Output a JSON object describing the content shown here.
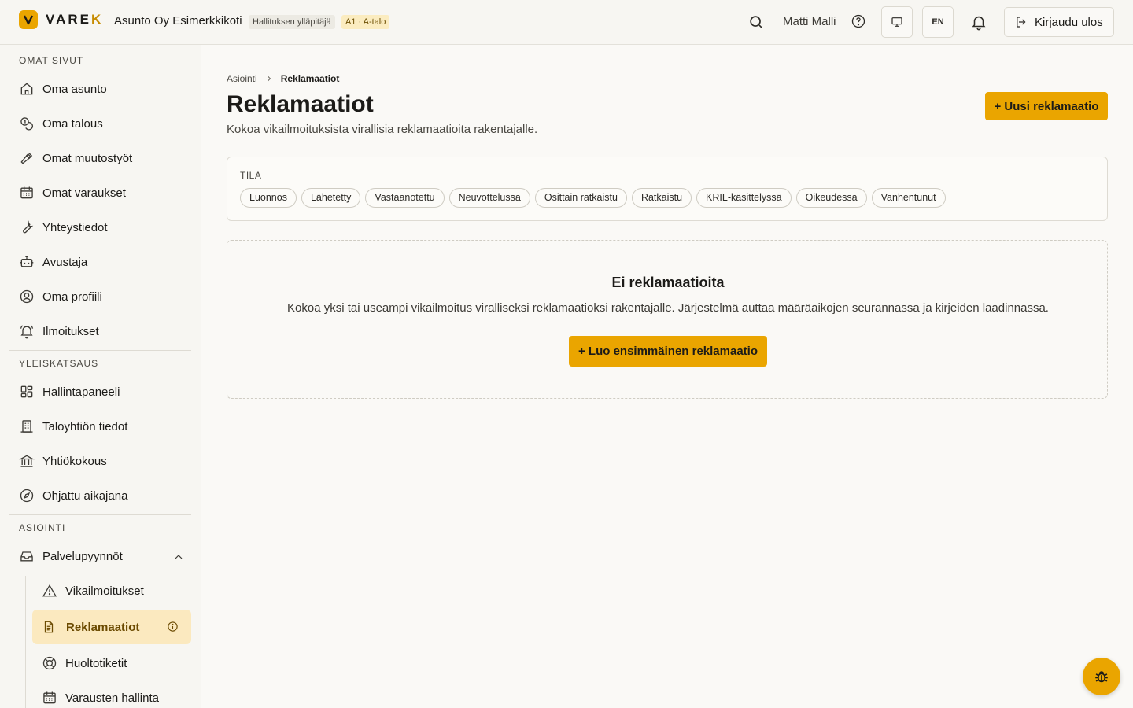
{
  "app": {
    "logo_text_main": "VARE",
    "logo_text_accent": "K",
    "org_name": "Asunto Oy Esimerkkikoti",
    "role_badge": "Hallituksen ylläpitäjä",
    "unit_badge": "A1 · A-talo",
    "brand_color": "#eaa500"
  },
  "header": {
    "user_name": "Matti Malli",
    "lang_label": "EN",
    "logout_label": "Kirjaudu ulos"
  },
  "sidebar": {
    "sections": [
      {
        "title": "OMAT SIVUT",
        "items": [
          {
            "label": "Oma asunto",
            "icon": "home-icon"
          },
          {
            "label": "Oma talous",
            "icon": "coins-icon"
          },
          {
            "label": "Omat muutostyöt",
            "icon": "hammer-icon"
          },
          {
            "label": "Omat varaukset",
            "icon": "calendar-icon"
          },
          {
            "label": "Yhteystiedot",
            "icon": "wrench-icon"
          },
          {
            "label": "Avustaja",
            "icon": "bot-icon"
          },
          {
            "label": "Oma profiili",
            "icon": "user-circle-icon"
          },
          {
            "label": "Ilmoitukset",
            "icon": "bell-ring-icon"
          }
        ]
      },
      {
        "title": "YLEISKATSAUS",
        "items": [
          {
            "label": "Hallintapaneeli",
            "icon": "dashboard-icon"
          },
          {
            "label": "Taloyhtiön tiedot",
            "icon": "building-icon"
          },
          {
            "label": "Yhtiökokous",
            "icon": "landmark-icon"
          },
          {
            "label": "Ohjattu aikajana",
            "icon": "compass-icon"
          }
        ]
      },
      {
        "title": "ASIOINTI",
        "items": [
          {
            "label": "Palvelupyynnöt",
            "icon": "inbox-icon"
          }
        ],
        "sub_items": [
          {
            "label": "Vikailmoitukset",
            "icon": "warning-icon"
          },
          {
            "label": "Reklamaatiot",
            "icon": "file-text-icon",
            "active": true
          },
          {
            "label": "Huoltotiketit",
            "icon": "lifebuoy-icon"
          },
          {
            "label": "Varausten hallinta",
            "icon": "calendar-icon"
          }
        ]
      }
    ]
  },
  "breadcrumb": {
    "parent": "Asiointi",
    "current": "Reklamaatiot"
  },
  "page": {
    "title": "Reklamaatiot",
    "subtitle": "Kokoa vikailmoituksista virallisia reklamaatioita rakentajalle.",
    "new_button": "+ Uusi reklamaatio"
  },
  "filters": {
    "label": "TILA",
    "chips": [
      "Luonnos",
      "Lähetetty",
      "Vastaanotettu",
      "Neuvottelussa",
      "Osittain ratkaistu",
      "Ratkaistu",
      "KRIL-käsittelyssä",
      "Oikeudessa",
      "Vanhentunut"
    ]
  },
  "empty_state": {
    "title": "Ei reklamaatioita",
    "text": "Kokoa yksi tai useampi vikailmoitus viralliseksi reklamaatioksi rakentajalle. Järjestelmä auttaa määräaikojen seurannassa ja kirjeiden laadinnassa.",
    "cta": "+ Luo ensimmäinen reklamaatio"
  }
}
